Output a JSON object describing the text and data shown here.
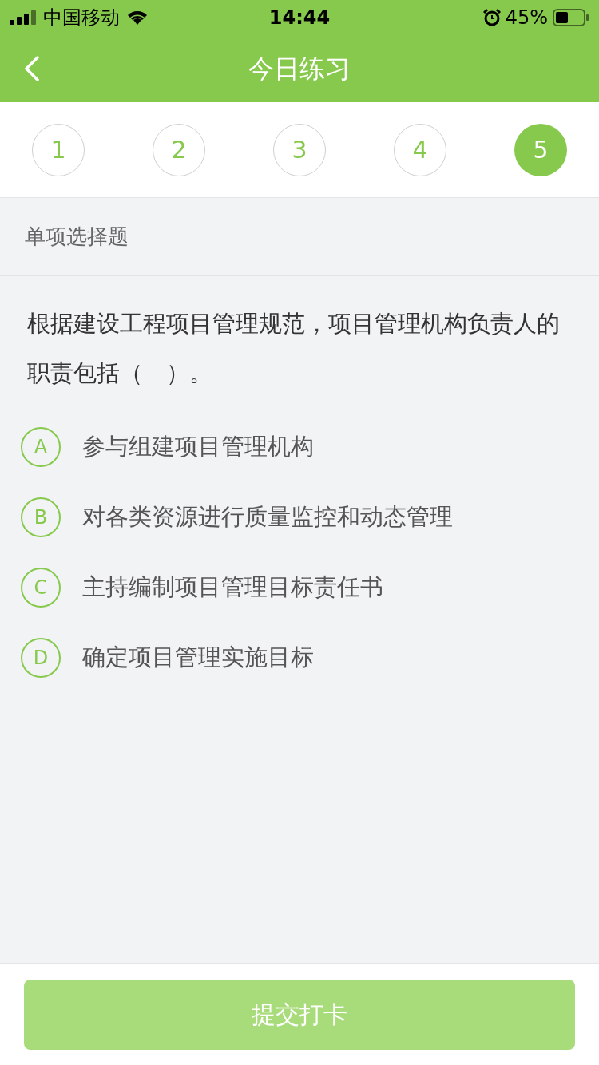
{
  "status_bar": {
    "carrier": "中国移动",
    "time": "14:44",
    "battery": "45%"
  },
  "header": {
    "title": "今日练习"
  },
  "steps": [
    {
      "label": "1",
      "selected": false
    },
    {
      "label": "2",
      "selected": false
    },
    {
      "label": "3",
      "selected": false
    },
    {
      "label": "4",
      "selected": false
    },
    {
      "label": "5",
      "selected": true
    }
  ],
  "question_type": "单项选择题",
  "question": "根据建设工程项目管理规范，项目管理机构负责人的职责包括（　）。",
  "options": [
    {
      "letter": "A",
      "text": "参与组建项目管理机构"
    },
    {
      "letter": "B",
      "text": "对各类资源进行质量监控和动态管理"
    },
    {
      "letter": "C",
      "text": "主持编制项目管理目标责任书"
    },
    {
      "letter": "D",
      "text": "确定项目管理实施目标"
    }
  ],
  "submit_button": {
    "label": "提交打卡",
    "disabled": true
  }
}
